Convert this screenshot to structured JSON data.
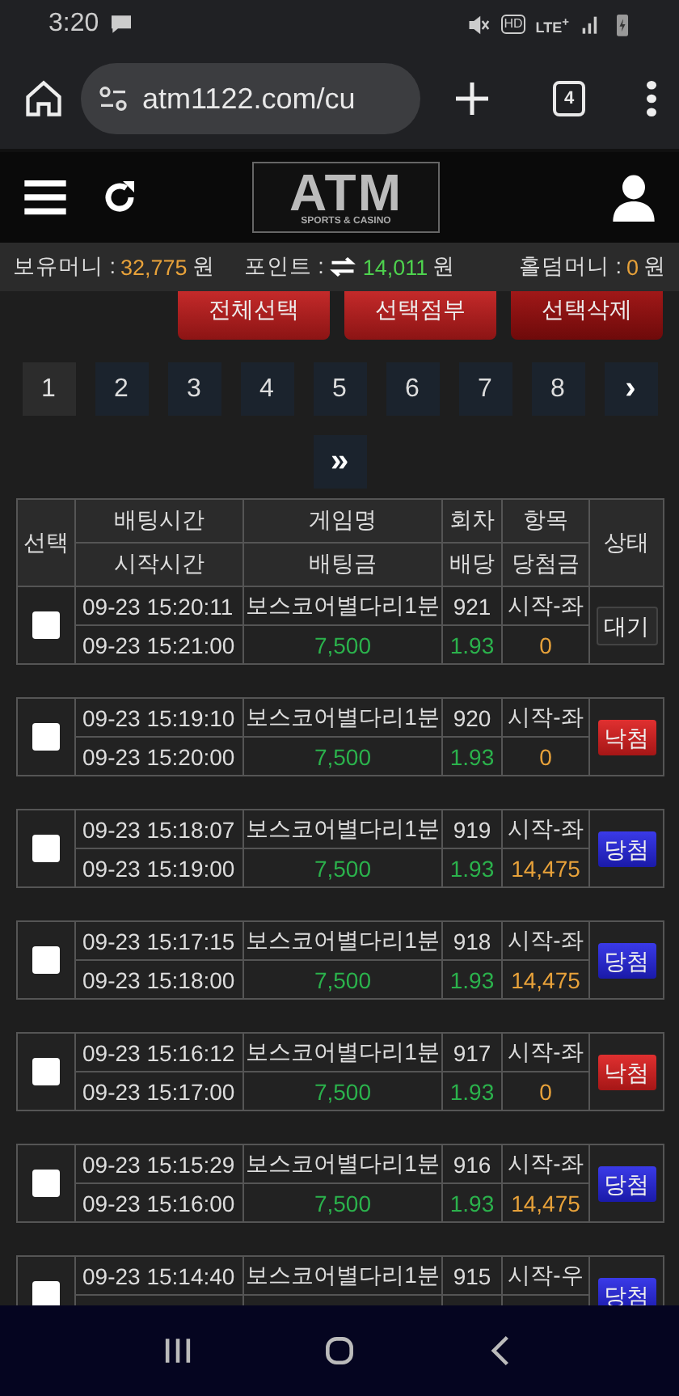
{
  "status_bar": {
    "time": "3:20",
    "hd": "HD",
    "network": "LTE$^{+}$"
  },
  "browser": {
    "url": "atm1122.com/cu",
    "tab_count": "4"
  },
  "logo": {
    "title": "ATM",
    "subtitle": "SPORTS & CASINO"
  },
  "balance": [
    {
      "label": "보유머니 :",
      "value": "32,775",
      "unit": "원",
      "kind": "money"
    },
    {
      "label": "포인트 :",
      "value": "14,011",
      "unit": "원",
      "kind": "point"
    },
    {
      "label": "홀덤머니 :",
      "value": "0",
      "unit": "원",
      "kind": "money"
    }
  ],
  "actions": [
    "전체선택",
    "선택점부",
    "선택삭제"
  ],
  "pagination": [
    {
      "label": "1",
      "selected": true
    },
    {
      "label": "2",
      "selected": false
    },
    {
      "label": "3",
      "selected": false
    },
    {
      "label": "4",
      "selected": false
    },
    {
      "label": "5",
      "selected": false
    },
    {
      "label": "6",
      "selected": false
    },
    {
      "label": "7",
      "selected": false
    },
    {
      "label": "8",
      "selected": false
    },
    {
      "label": "›",
      "selected": false
    },
    {
      "label": "»",
      "selected": false
    }
  ],
  "table": {
    "columns": {
      "select": "선택",
      "bet_time": "배팅시간",
      "start_time": "시작시간",
      "game": "게임명",
      "amount": "배팅금",
      "round": "회차",
      "odds": "배당",
      "pick": "항목",
      "payout": "당첨금",
      "status": "상태"
    },
    "rows": [
      {
        "checked": false,
        "bet_time": "09-23 15:20:11",
        "start_time": "09-23 15:21:00",
        "game": "보스코어별다리1분",
        "amount": "7,500",
        "round": "921",
        "odds": "1.93",
        "pick": "시작-좌",
        "payout": "0",
        "status": {
          "label": "대기",
          "kind": "wait"
        }
      },
      {
        "checked": false,
        "bet_time": "09-23 15:19:10",
        "start_time": "09-23 15:20:00",
        "game": "보스코어별다리1분",
        "amount": "7,500",
        "round": "920",
        "odds": "1.93",
        "pick": "시작-좌",
        "payout": "0",
        "status": {
          "label": "낙첨",
          "kind": "lose"
        }
      },
      {
        "checked": false,
        "bet_time": "09-23 15:18:07",
        "start_time": "09-23 15:19:00",
        "game": "보스코어별다리1분",
        "amount": "7,500",
        "round": "919",
        "odds": "1.93",
        "pick": "시작-좌",
        "payout": "14,475",
        "status": {
          "label": "당첨",
          "kind": "win"
        }
      },
      {
        "checked": false,
        "bet_time": "09-23 15:17:15",
        "start_time": "09-23 15:18:00",
        "game": "보스코어별다리1분",
        "amount": "7,500",
        "round": "918",
        "odds": "1.93",
        "pick": "시작-좌",
        "payout": "14,475",
        "status": {
          "label": "당첨",
          "kind": "win"
        }
      },
      {
        "checked": false,
        "bet_time": "09-23 15:16:12",
        "start_time": "09-23 15:17:00",
        "game": "보스코어별다리1분",
        "amount": "7,500",
        "round": "917",
        "odds": "1.93",
        "pick": "시작-좌",
        "payout": "0",
        "status": {
          "label": "낙첨",
          "kind": "lose"
        }
      },
      {
        "checked": false,
        "bet_time": "09-23 15:15:29",
        "start_time": "09-23 15:16:00",
        "game": "보스코어별다리1분",
        "amount": "7,500",
        "round": "916",
        "odds": "1.93",
        "pick": "시작-좌",
        "payout": "14,475",
        "status": {
          "label": "당첨",
          "kind": "win"
        }
      },
      {
        "checked": false,
        "bet_time": "09-23 15:14:40",
        "game": "보스코어별다리1분",
        "round": "915",
        "pick": "시작-우",
        "status": {
          "label": "당첨",
          "kind": "win"
        }
      }
    ]
  }
}
